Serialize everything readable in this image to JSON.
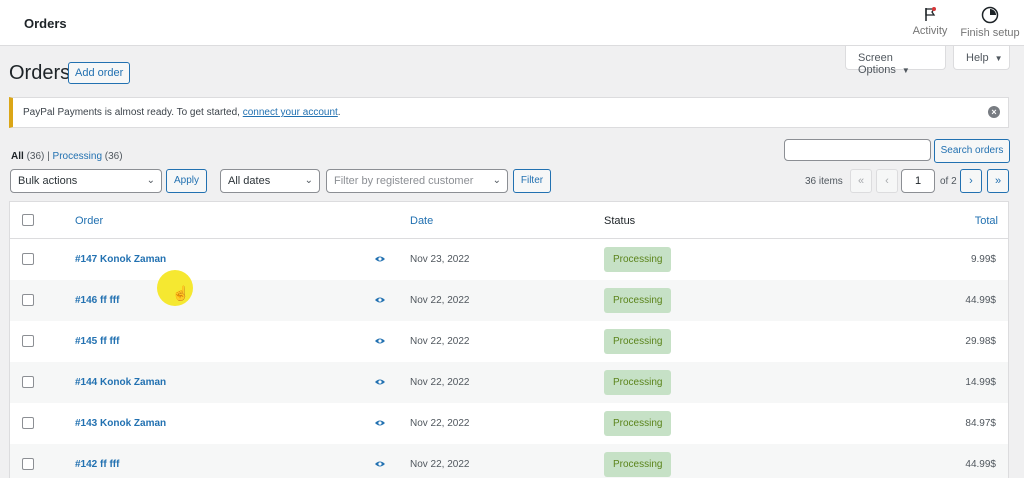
{
  "topbar": {
    "title": "Orders",
    "activity_label": "Activity",
    "finish_setup_label": "Finish setup"
  },
  "screen_options_label": "Screen Options",
  "help_label": "Help",
  "page_title": "Orders",
  "add_order_label": "Add order",
  "notice": {
    "text": "PayPal Payments is almost ready. To get started,",
    "link": "connect your account",
    "after": "."
  },
  "views": {
    "all_label": "All",
    "all_count": "(36)",
    "separator": "|",
    "processing_label": "Processing",
    "processing_count": "(36)"
  },
  "search": {
    "value": "",
    "button_label": "Search orders"
  },
  "filters": {
    "bulk_actions": "Bulk actions",
    "apply_label": "Apply",
    "dates": "All dates",
    "customer_placeholder": "Filter by registered customer",
    "filter_label": "Filter"
  },
  "pagination": {
    "items": "36 items",
    "first": "«",
    "prev": "‹",
    "current_page": "1",
    "of_total": "of 2",
    "next": "›",
    "last": "»"
  },
  "table": {
    "columns": {
      "order": "Order",
      "date": "Date",
      "status": "Status",
      "total": "Total"
    },
    "rows": [
      {
        "order": "#147 Konok Zaman",
        "date": "Nov 23, 2022",
        "status": "Processing",
        "total": "9.99$"
      },
      {
        "order": "#146 ff fff",
        "date": "Nov 22, 2022",
        "status": "Processing",
        "total": "44.99$"
      },
      {
        "order": "#145 ff fff",
        "date": "Nov 22, 2022",
        "status": "Processing",
        "total": "29.98$"
      },
      {
        "order": "#144 Konok Zaman",
        "date": "Nov 22, 2022",
        "status": "Processing",
        "total": "14.99$"
      },
      {
        "order": "#143 Konok Zaman",
        "date": "Nov 22, 2022",
        "status": "Processing",
        "total": "84.97$"
      },
      {
        "order": "#142 ff fff",
        "date": "Nov 22, 2022",
        "status": "Processing",
        "total": "44.99$"
      }
    ]
  },
  "colors": {
    "accent": "#2271b1",
    "processing_bg": "#c6e1c6",
    "processing_text": "#5b841b",
    "notice_border": "#dba617"
  },
  "icons": {
    "activity": "flag-icon",
    "finish_setup": "progress-circle-icon",
    "preview": "eye-icon",
    "dismiss": "close-icon"
  }
}
